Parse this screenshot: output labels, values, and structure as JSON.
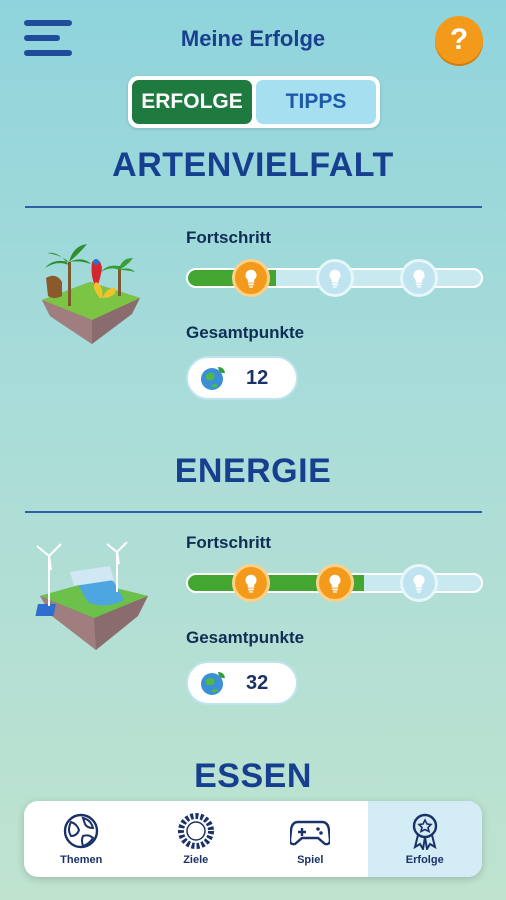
{
  "header": {
    "title": "Meine Erfolge",
    "help_label": "?"
  },
  "tabs": [
    {
      "label": "ERFOLGE",
      "active": true
    },
    {
      "label": "TIPPS",
      "active": false
    }
  ],
  "sections": [
    {
      "title": "ARTENVIELFALT",
      "progress_label": "Fortschritt",
      "progress_fraction": 0.3,
      "milestones_reached": 1,
      "milestones_total": 3,
      "points_label": "Gesamtpunkte",
      "points": "12"
    },
    {
      "title": "ENERGIE",
      "progress_label": "Fortschritt",
      "progress_fraction": 0.6,
      "milestones_reached": 2,
      "milestones_total": 3,
      "points_label": "Gesamtpunkte",
      "points": "32"
    },
    {
      "title": "ESSEN"
    }
  ],
  "nav": [
    {
      "label": "Themen",
      "icon": "globe-icon"
    },
    {
      "label": "Ziele",
      "icon": "goals-ring-icon"
    },
    {
      "label": "Spiel",
      "icon": "gamepad-icon"
    },
    {
      "label": "Erfolge",
      "icon": "award-icon",
      "active": true
    }
  ],
  "colors": {
    "accent_green": "#1e7a3e",
    "progress_green": "#43a631",
    "bulb_orange": "#f39a1a",
    "title_blue": "#16408f"
  }
}
